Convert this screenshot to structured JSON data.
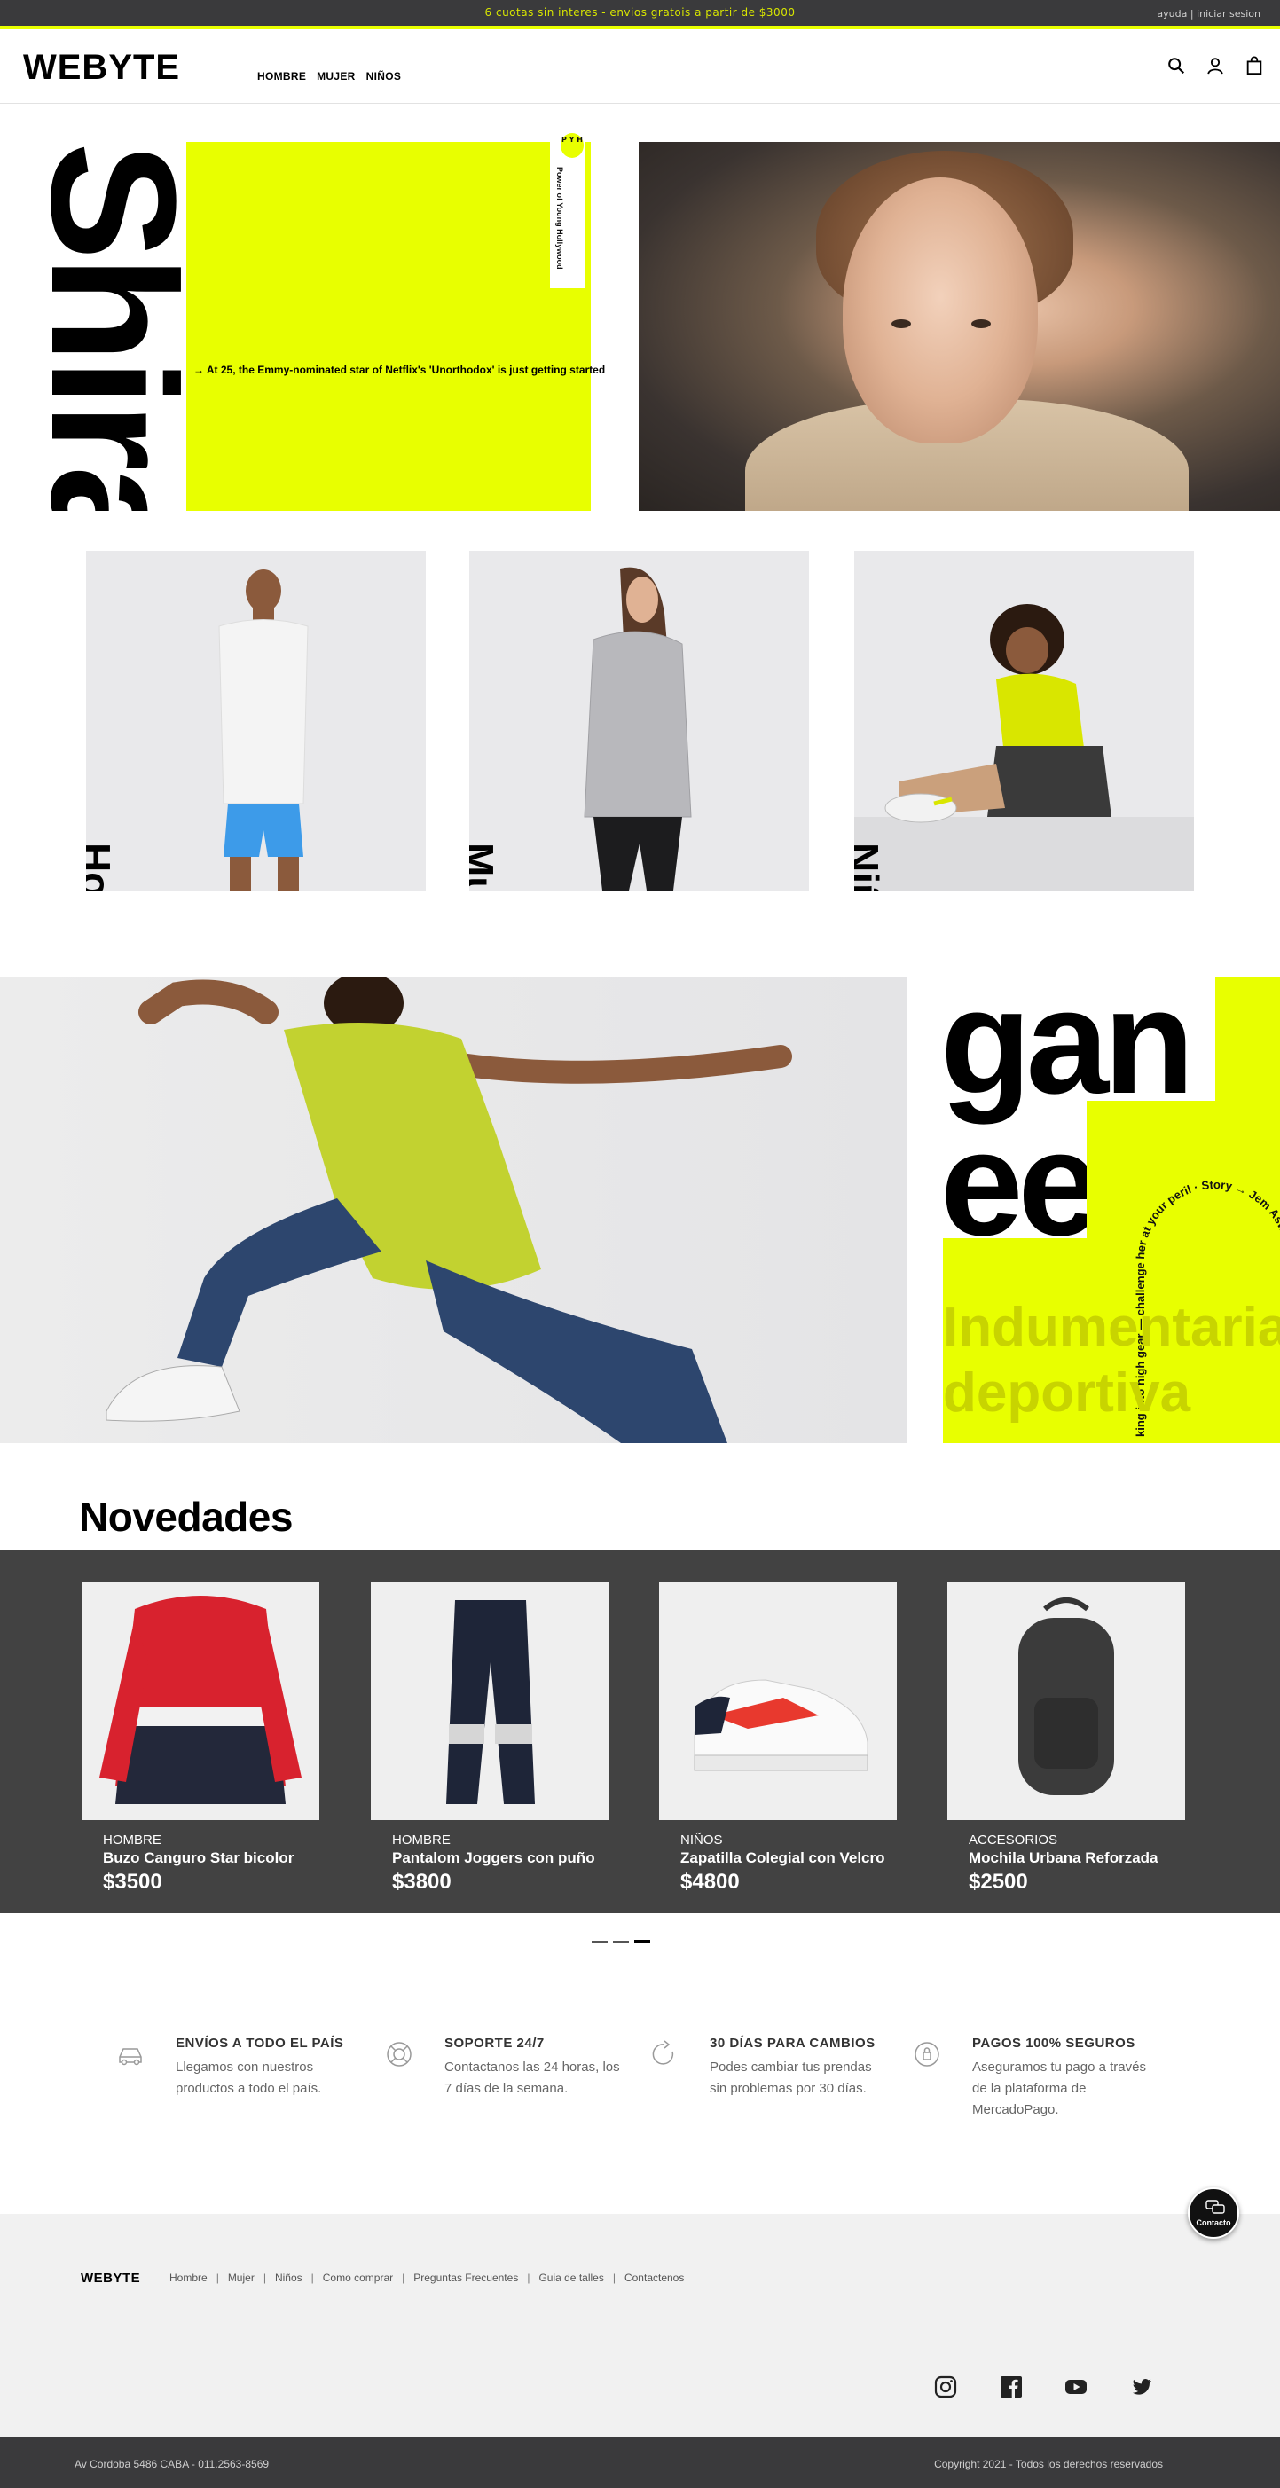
{
  "topbar": {
    "promo": "6 cuotas sin interes - envios gratois a partir de $3000",
    "help": "ayuda",
    "divider": "|",
    "login": "iniciar sesion"
  },
  "header": {
    "logo": "WEBYTE",
    "nav": [
      "HOMBRE",
      "MUJER",
      "NIÑOS"
    ],
    "icons": [
      "search-icon",
      "user-icon",
      "shopping-bag-icon"
    ]
  },
  "hero": {
    "word": "Shira",
    "badge": "P Y H",
    "vertical_text": "Power of Young Hollywood",
    "caption": "→ At 25, the Emmy-nominated star of Netflix's 'Unorthodox' is just getting started",
    "accent": "#e8ff00"
  },
  "categories": [
    {
      "label": "Hombre"
    },
    {
      "label": "Mujer"
    },
    {
      "label": "Niños"
    }
  ],
  "promo": {
    "word1": "gan",
    "word2": "ee",
    "arc_text": "king into high gear — challenge her at your peril · Story → Jem Aswad · Photographs → Orri Heurmont",
    "title_line1": "Indumentaria",
    "title_line2": "deportiva"
  },
  "novedades": {
    "title": "Novedades",
    "products": [
      {
        "category": "HOMBRE",
        "name": "Buzo Canguro Star bicolor",
        "price": "$3500"
      },
      {
        "category": "HOMBRE",
        "name": "Pantalom Joggers con puño",
        "price": "$3800"
      },
      {
        "category": "NIÑOS",
        "name": "Zapatilla Colegial con Velcro",
        "price": "$4800"
      },
      {
        "category": "ACCESORiOS",
        "name": "Mochila Urbana Reforzada",
        "price": "$2500"
      }
    ],
    "carousel_active": 3
  },
  "features": [
    {
      "title": "ENVÍOS A TODO EL PAÍS",
      "desc": "Llegamos con nuestros productos a todo el país.",
      "icon": "car-icon"
    },
    {
      "title": "SOPORTE 24/7",
      "desc": "Contactanos las 24 horas, los 7 días de la semana.",
      "icon": "lifebuoy-icon"
    },
    {
      "title": "30 DÍAS PARA CAMBIOS",
      "desc": "Podes cambiar tus prendas sin problemas por 30 días.",
      "icon": "return-arrow-icon"
    },
    {
      "title": "PAGOS 100% SEGUROS",
      "desc": "Aseguramos tu pago a través de la plataforma de MercadoPago.",
      "icon": "secure-payment-icon"
    }
  ],
  "chat": {
    "label": "Contacto"
  },
  "footer": {
    "logo": "WEBYTE",
    "links": [
      "Hombre",
      "Mujer",
      "Niños",
      "Como comprar",
      "Preguntas Frecuentes",
      "Guia de talles",
      "Contactenos"
    ],
    "social": [
      "instagram-icon",
      "facebook-icon",
      "youtube-icon",
      "twitter-icon"
    ],
    "address": "Av Cordoba 5486 CABA - 011.2563-8569",
    "copyright": "Copyright 2021 - Todos los derechos reservados"
  }
}
